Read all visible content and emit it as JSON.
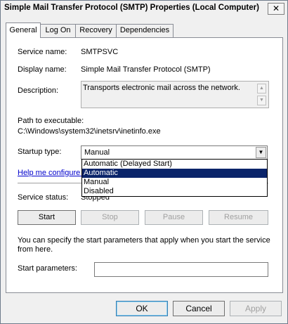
{
  "window": {
    "title": "Simple Mail Transfer Protocol (SMTP) Properties (Local Computer)",
    "close_glyph": "✕"
  },
  "tabs": [
    {
      "label": "General"
    },
    {
      "label": "Log On"
    },
    {
      "label": "Recovery"
    },
    {
      "label": "Dependencies"
    }
  ],
  "general": {
    "service_name_label": "Service name:",
    "service_name": "SMTPSVC",
    "display_name_label": "Display name:",
    "display_name": "Simple Mail Transfer Protocol (SMTP)",
    "description_label": "Description:",
    "description": "Transports electronic mail across the network.",
    "path_label": "Path to executable:",
    "path": "C:\\Windows\\system32\\inetsrv\\inetinfo.exe",
    "startup_type_label": "Startup type:",
    "startup_type": "Manual",
    "startup_options": [
      "Automatic (Delayed Start)",
      "Automatic",
      "Manual",
      "Disabled"
    ],
    "startup_highlighted": "Automatic",
    "help_link": "Help me configure s",
    "service_status_label": "Service status:",
    "service_status": "Stopped",
    "buttons": {
      "start": "Start",
      "stop": "Stop",
      "pause": "Pause",
      "resume": "Resume"
    },
    "params_info": "You can specify the start parameters that apply when you start the service from here.",
    "params_info_line1": "You can specify the start parameters that apply when you start the service",
    "params_info_line2": "from here.",
    "start_params_label": "Start parameters:",
    "start_params_value": ""
  },
  "footer": {
    "ok": "OK",
    "cancel": "Cancel",
    "apply": "Apply"
  },
  "colors": {
    "highlight": "#0a246a",
    "link": "#0000cc"
  }
}
